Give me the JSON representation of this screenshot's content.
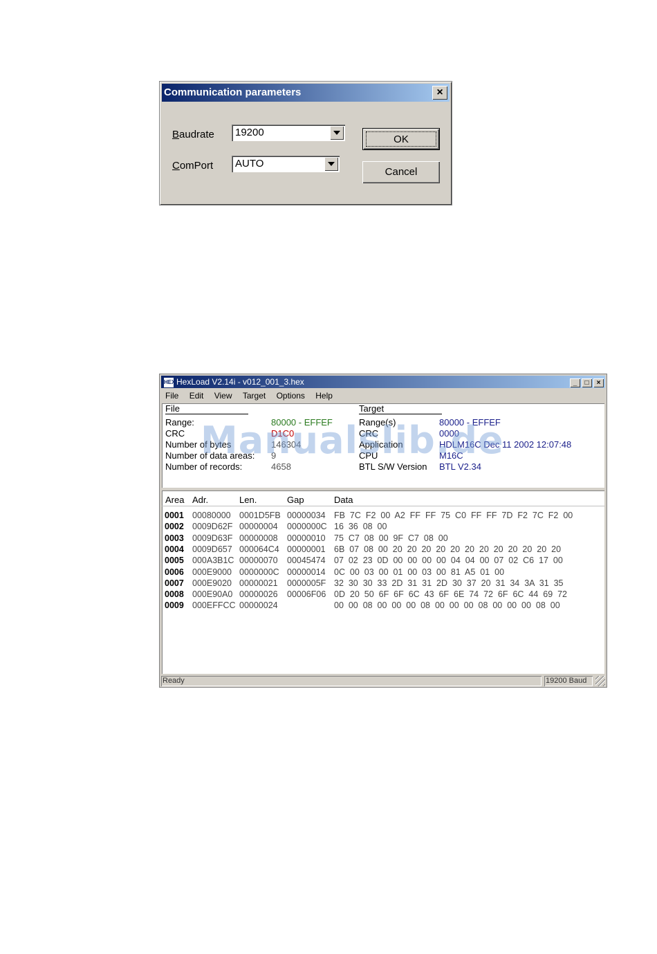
{
  "dialog": {
    "title": "Communication parameters",
    "close_symbol": "×",
    "baudrate_label_access": "B",
    "baudrate_label_rest": "audrate",
    "baudrate_value": "19200",
    "comport_label_access": "C",
    "comport_label_rest": "omPort",
    "comport_value": "AUTO",
    "ok_label": "OK",
    "cancel_label": "Cancel"
  },
  "app": {
    "title": "HexLoad V2.14i - v012_001_3.hex",
    "icon_text": "HEX",
    "minimize": "_",
    "maximize": "□",
    "close": "×",
    "menu": [
      "File",
      "Edit",
      "View",
      "Target",
      "Options",
      "Help"
    ],
    "file_section": {
      "heading": "File",
      "rows": [
        {
          "label": "Range:",
          "value": "80000 - EFFEF"
        },
        {
          "label": "CRC",
          "value": "D1C0"
        },
        {
          "label": "Number of bytes",
          "value": "146304"
        },
        {
          "label": "Number of data areas:",
          "value": "9"
        },
        {
          "label": "Number of records:",
          "value": "4658"
        }
      ]
    },
    "target_section": {
      "heading": "Target",
      "rows": [
        {
          "label": "Range(s)",
          "value": "80000 - EFFEF"
        },
        {
          "label": "CRC",
          "value": "0000"
        },
        {
          "label": "Application",
          "value": "HDLM16C Dec 11 2002 12:07:48"
        },
        {
          "label": "CPU",
          "value": "M16C"
        },
        {
          "label": "BTL S/W Version",
          "value": "BTL V2.34"
        }
      ]
    },
    "table": {
      "headers": [
        "Area",
        "Adr.",
        "Len.",
        "Gap",
        "Data"
      ],
      "rows": [
        [
          "0001",
          "00080000",
          "0001D5FB",
          "00000034",
          "FB  7C  F2  00  A2  FF  FF  75  C0  FF  FF  7D  F2  7C  F2  00"
        ],
        [
          "0002",
          "0009D62F",
          "00000004",
          "0000000C",
          "16  36  08  00"
        ],
        [
          "0003",
          "0009D63F",
          "00000008",
          "00000010",
          "75  C7  08  00  9F  C7  08  00"
        ],
        [
          "0004",
          "0009D657",
          "000064C4",
          "00000001",
          "6B  07  08  00  20  20  20  20  20  20  20  20  20  20  20  20"
        ],
        [
          "0005",
          "000A3B1C",
          "00000070",
          "00045474",
          "07  02  23  0D  00  00  00  00  04  04  00  07  02  C6  17  00"
        ],
        [
          "0006",
          "000E9000",
          "0000000C",
          "00000014",
          "0C  00  03  00  01  00  03  00  81  A5  01  00"
        ],
        [
          "0007",
          "000E9020",
          "00000021",
          "0000005F",
          "32  30  30  33  2D  31  31  2D  30  37  20  31  34  3A  31  35"
        ],
        [
          "0008",
          "000E90A0",
          "00000026",
          "00006F06",
          "0D  20  50  6F  6F  6C  43  6F  6E  74  72  6F  6C  44  69  72"
        ],
        [
          "0009",
          "000EFFCC",
          "00000024",
          "",
          "00  00  08  00  00  00  08  00  00  00  08  00  00  00  08  00"
        ]
      ]
    },
    "status": {
      "left": "Ready",
      "right": "19200 Baud"
    }
  },
  "watermark": "Manualslib.de",
  "colors": {
    "title_start": "#0a246a",
    "title_end": "#a6caf0",
    "face": "#d4d0c8",
    "file_range": "#2a7a1e",
    "file_crc": "#c00000",
    "target_values": "#1a1f8a"
  }
}
